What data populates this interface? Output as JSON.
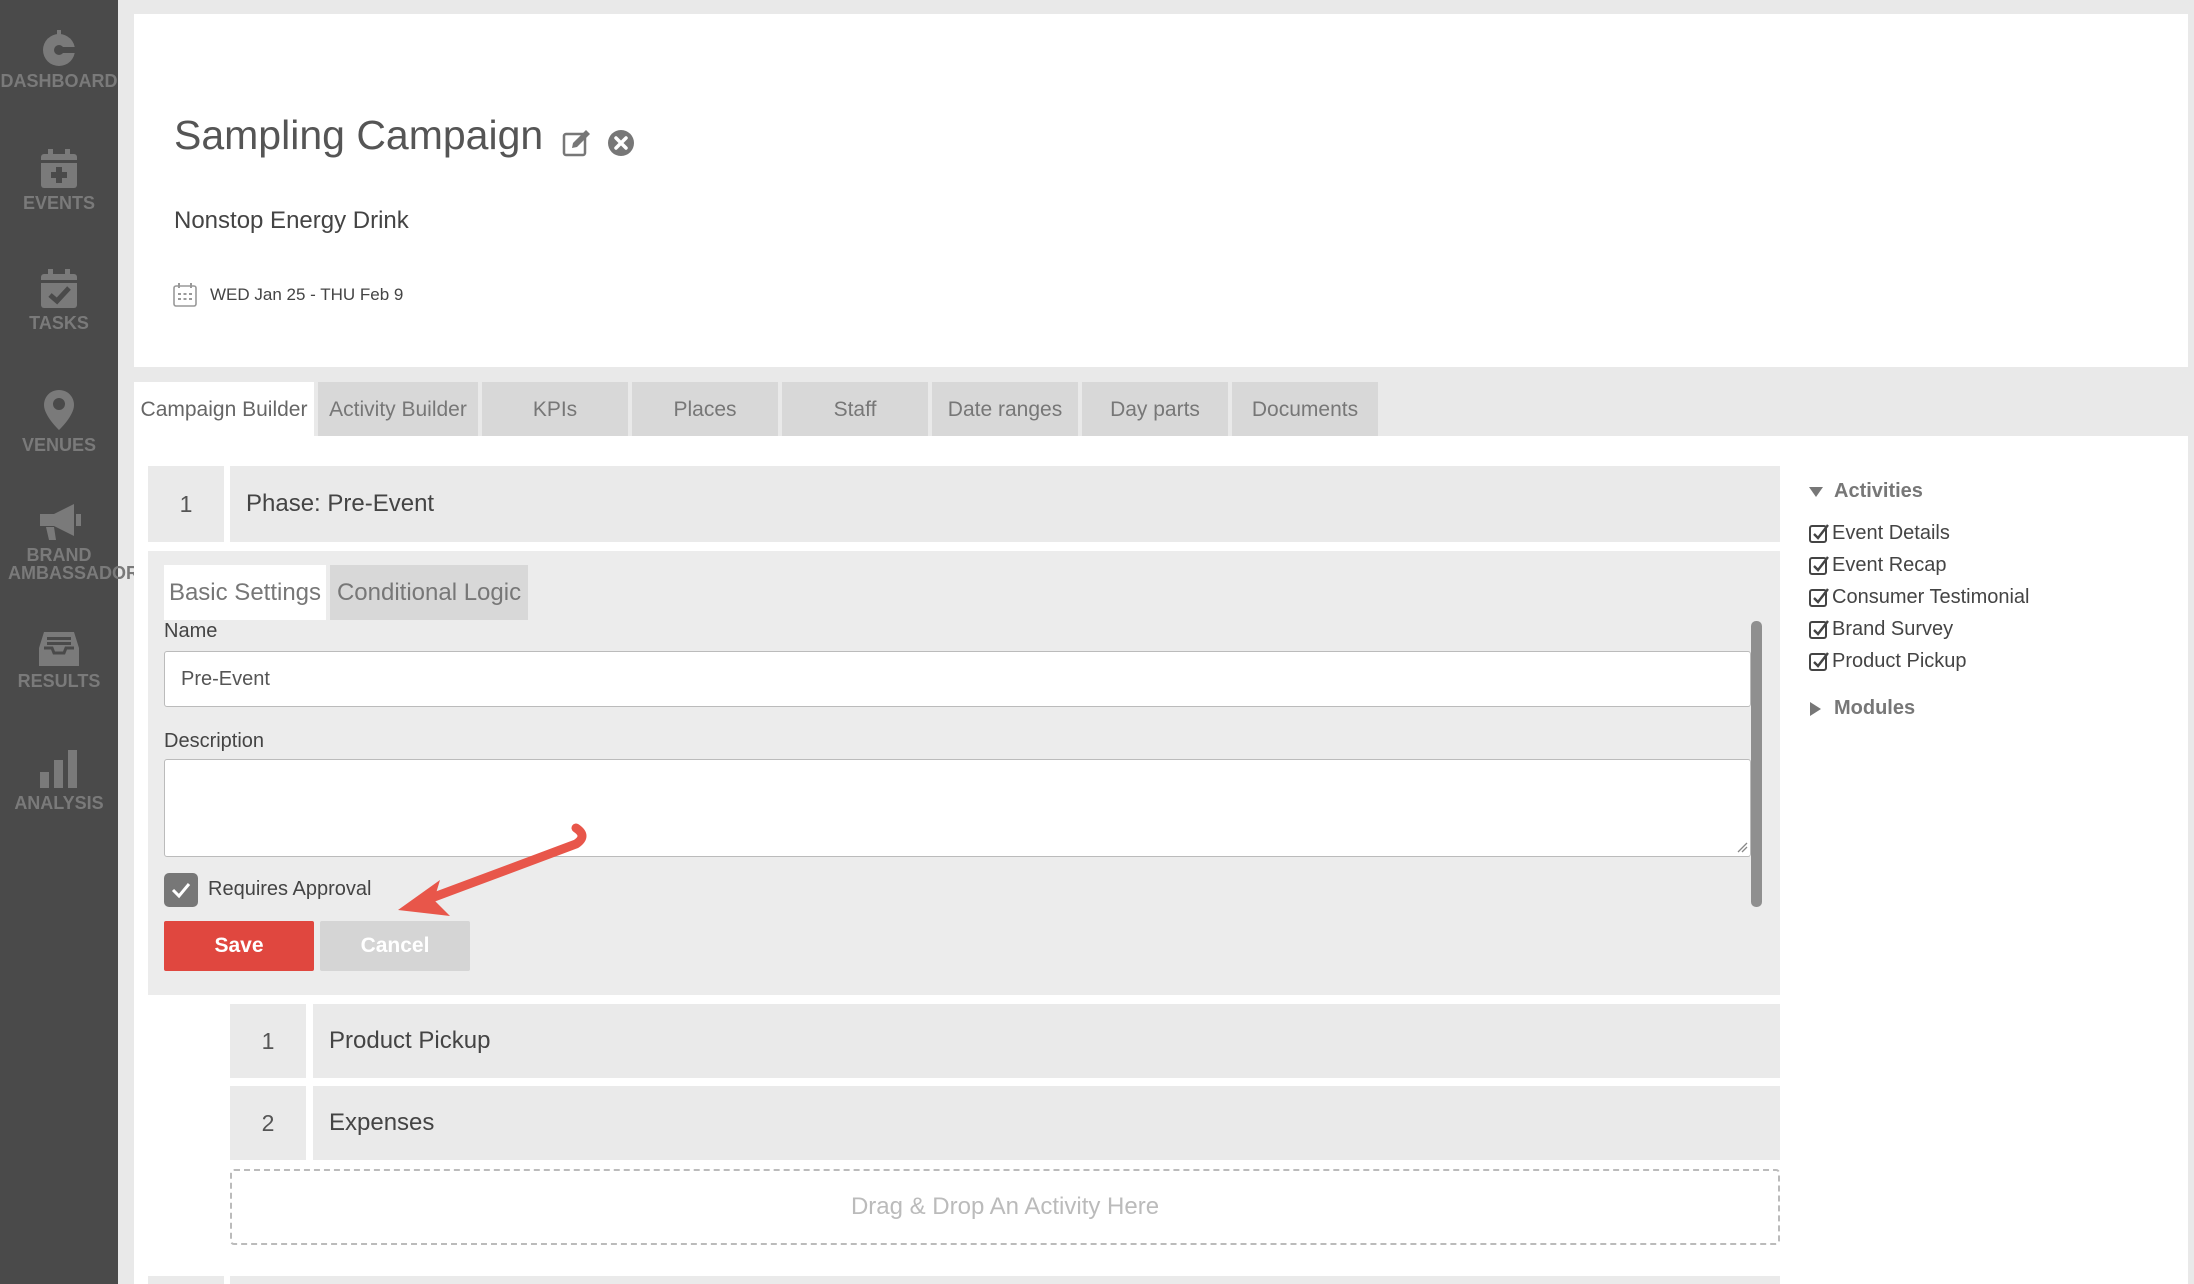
{
  "sidebar": {
    "items": [
      {
        "label": "DASHBOARD",
        "icon": "dashboard-icon"
      },
      {
        "label": "EVENTS",
        "icon": "calendar-plus-icon"
      },
      {
        "label": "TASKS",
        "icon": "calendar-check-icon"
      },
      {
        "label": "VENUES",
        "icon": "map-pin-icon"
      },
      {
        "label": "BRAND",
        "label2": "AMBASSADORS",
        "icon": "megaphone-icon"
      },
      {
        "label": "RESULTS",
        "icon": "inbox-icon"
      },
      {
        "label": "ANALYSIS",
        "icon": "bar-chart-icon"
      }
    ]
  },
  "header": {
    "title": "Sampling Campaign",
    "brand": "Nonstop Energy Drink",
    "date_range": "WED Jan 25 - THU Feb 9"
  },
  "tabs": [
    {
      "label": "Campaign Builder",
      "active": true
    },
    {
      "label": "Activity Builder"
    },
    {
      "label": "KPIs"
    },
    {
      "label": "Places"
    },
    {
      "label": "Staff"
    },
    {
      "label": "Date ranges"
    },
    {
      "label": "Day parts"
    },
    {
      "label": "Documents"
    }
  ],
  "phase": {
    "number": "1",
    "title": "Phase: Pre-Event",
    "subtabs": [
      "Basic Settings",
      "Conditional Logic"
    ],
    "name_label": "Name",
    "name_value": "Pre-Event",
    "description_label": "Description",
    "description_value": "",
    "requires_approval_label": "Requires Approval",
    "requires_approval_checked": true,
    "save_label": "Save",
    "cancel_label": "Cancel"
  },
  "activities_list": [
    {
      "number": "1",
      "label": "Product Pickup"
    },
    {
      "number": "2",
      "label": "Expenses"
    }
  ],
  "dropzone_label": "Drag & Drop An Activity Here",
  "right_panel": {
    "activities_heading": "Activities",
    "activities": [
      "Event Details",
      "Event Recap",
      "Consumer Testimonial",
      "Brand Survey",
      "Product Pickup"
    ],
    "modules_heading": "Modules"
  },
  "colors": {
    "sidebar_bg": "#4a4a4a",
    "save_button": "#e0473f",
    "arrow": "#e8564a"
  }
}
